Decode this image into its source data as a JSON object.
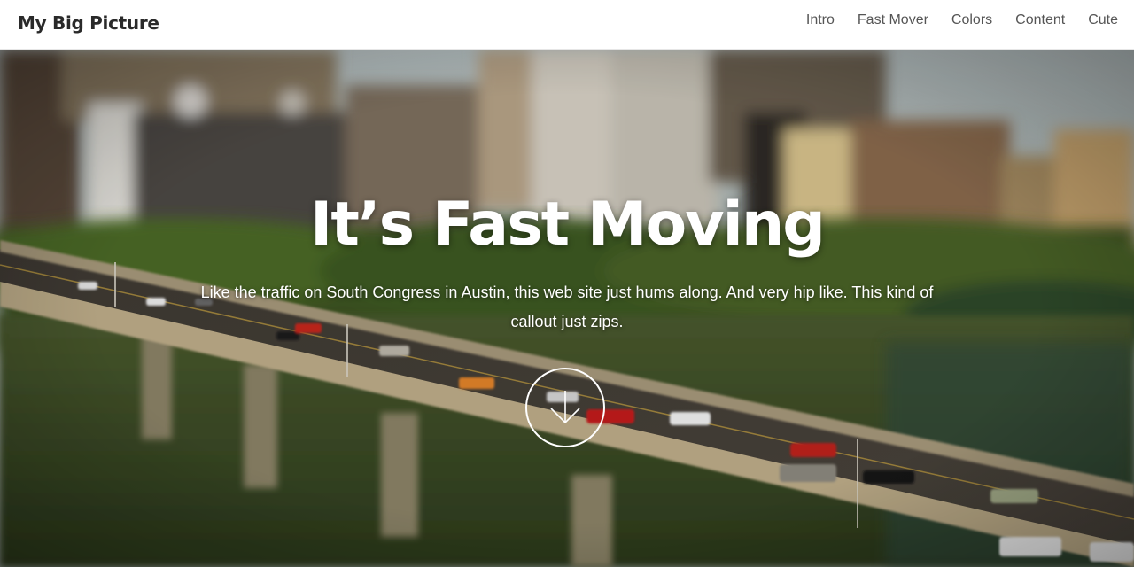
{
  "navbar": {
    "brand": "My Big Picture",
    "links": [
      {
        "label": "Intro"
      },
      {
        "label": "Fast Mover"
      },
      {
        "label": "Colors"
      },
      {
        "label": "Content"
      },
      {
        "label": "Cute"
      }
    ]
  },
  "hero": {
    "title": "It’s Fast Moving",
    "subtitle": "Like the traffic on South Congress in Austin, this web site just hums along. And very hip like. This kind of callout just zips.",
    "scroll_icon": "arrow-down-icon"
  },
  "colors": {
    "nav_bg": "#ffffff",
    "brand_text": "#2a2a2a",
    "nav_text": "#555555",
    "hero_text": "#ffffff"
  }
}
